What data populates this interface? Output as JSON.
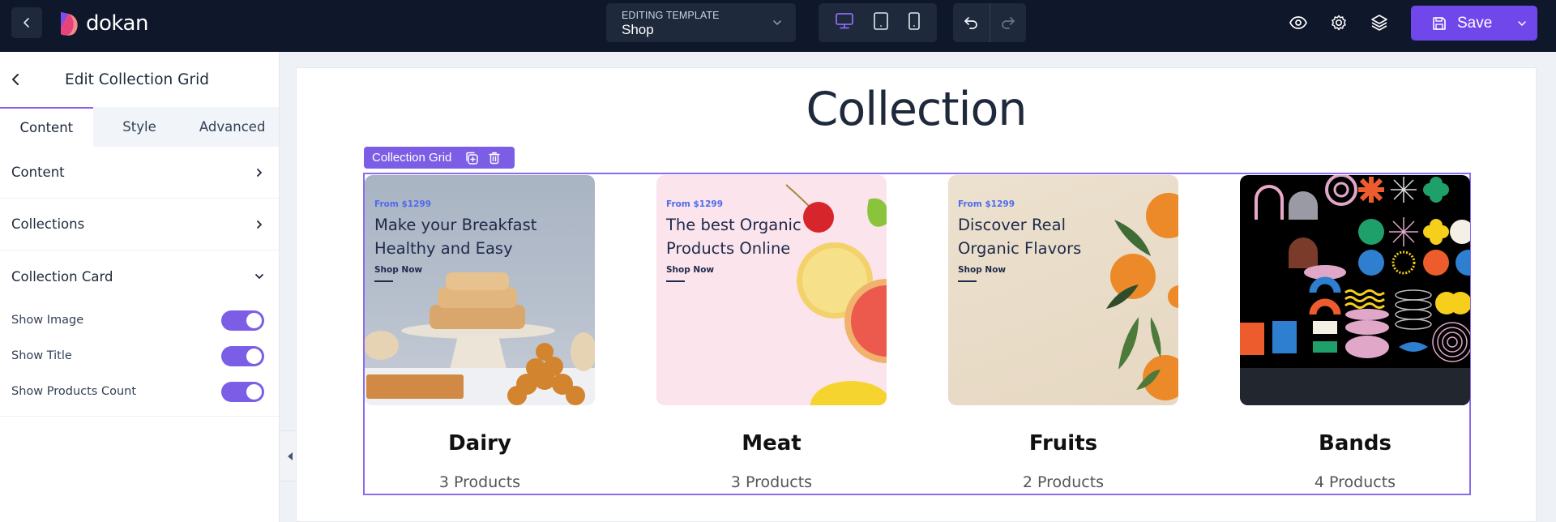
{
  "topbar": {
    "logo_text": "dokan",
    "template_label": "EDITING TEMPLATE",
    "template_value": "Shop",
    "devices": [
      {
        "name": "desktop",
        "active": true
      },
      {
        "name": "tablet",
        "active": false
      },
      {
        "name": "mobile",
        "active": false
      }
    ],
    "save_label": "Save"
  },
  "sidebar": {
    "title": "Edit Collection Grid",
    "tabs": [
      {
        "label": "Content",
        "active": true
      },
      {
        "label": "Style",
        "active": false
      },
      {
        "label": "Advanced",
        "active": false
      }
    ],
    "sections": [
      {
        "label": "Content",
        "expanded": false
      },
      {
        "label": "Collections",
        "expanded": false
      },
      {
        "label": "Collection Card",
        "expanded": true
      }
    ],
    "toggles": [
      {
        "label": "Show Image",
        "on": true
      },
      {
        "label": "Show Title",
        "on": true
      },
      {
        "label": "Show Products Count",
        "on": true
      }
    ]
  },
  "canvas": {
    "heading": "Collection",
    "widget_label": "Collection Grid",
    "cards": [
      {
        "title": "Dairy",
        "count": "3 Products",
        "promo_from": "From $1299",
        "promo_title_1": "Make your Breakfast",
        "promo_title_2": "Healthy and Easy",
        "promo_link": "Shop Now"
      },
      {
        "title": "Meat",
        "count": "3 Products",
        "promo_from": "From $1299",
        "promo_title_1": "The best Organic",
        "promo_title_2": "Products Online",
        "promo_link": "Shop Now"
      },
      {
        "title": "Fruits",
        "count": "2 Products",
        "promo_from": "From $1299",
        "promo_title_1": "Discover Real",
        "promo_title_2": "Organic Flavors",
        "promo_link": "Shop Now"
      },
      {
        "title": "Bands",
        "count": "4 Products"
      }
    ]
  },
  "colors": {
    "accent": "#7047eb",
    "selection": "#8b6cf0",
    "topbar_bg": "#0f172a"
  }
}
